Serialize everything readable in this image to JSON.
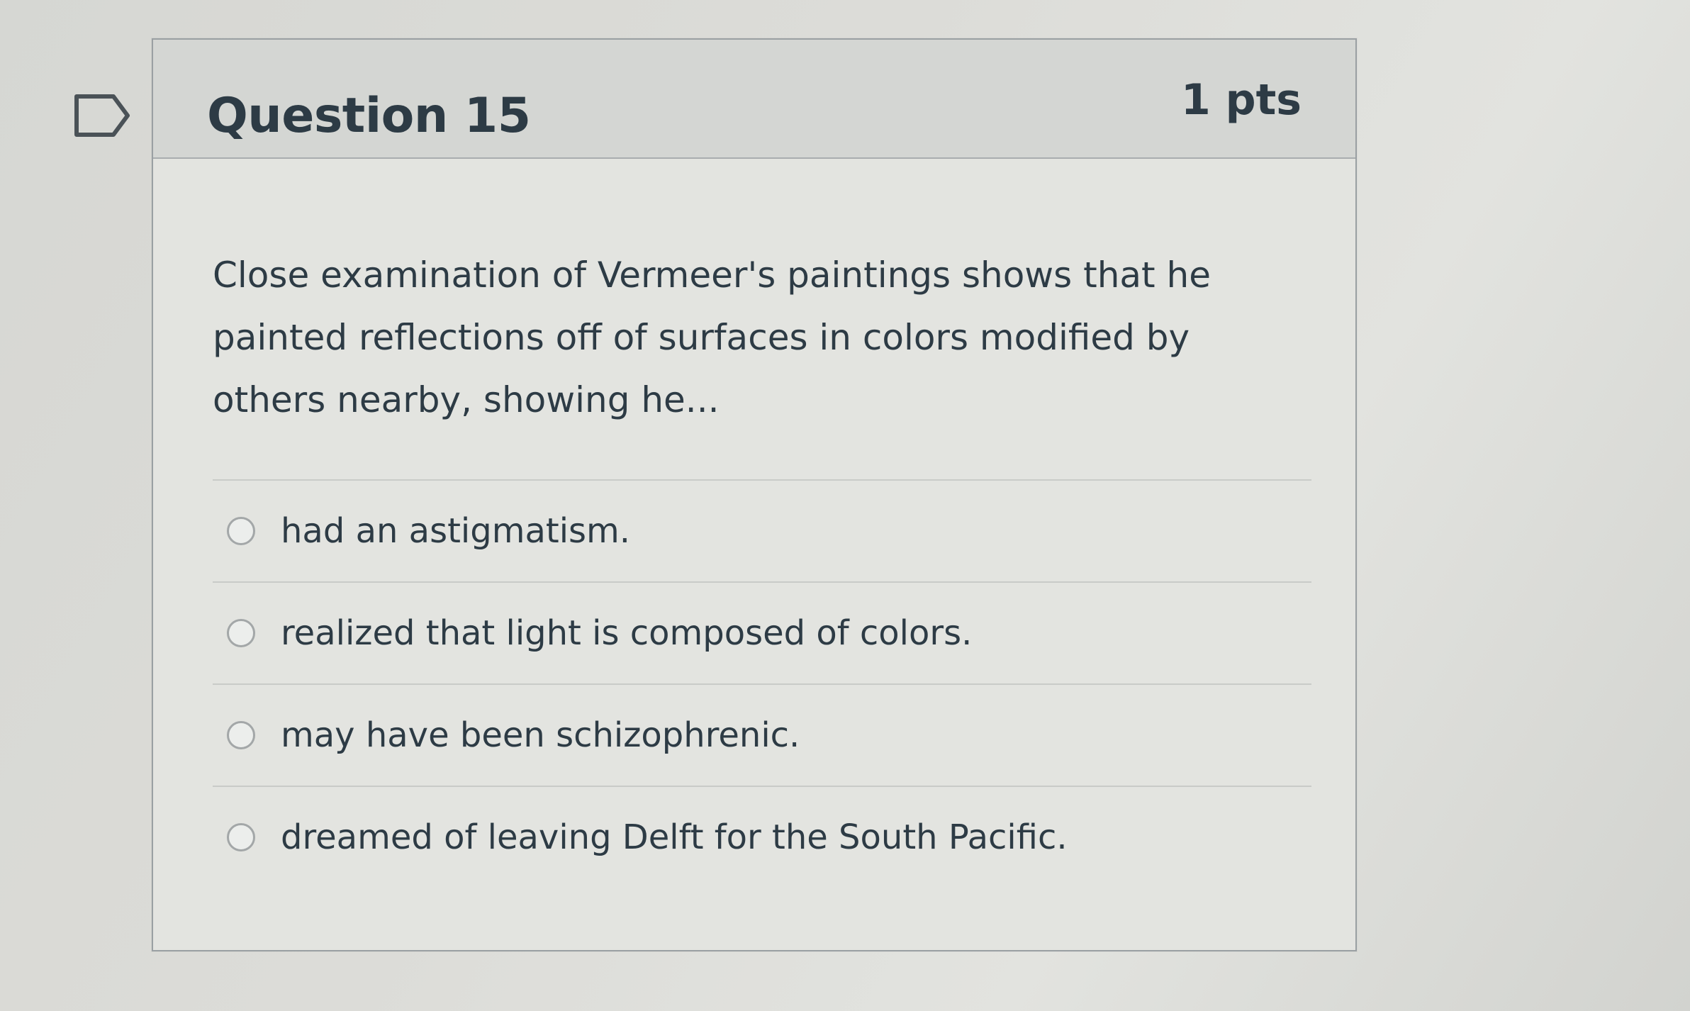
{
  "question": {
    "title": "Question 15",
    "points": "1 pts",
    "text": "Close examination of Vermeer's paintings shows that he painted reflections off of surfaces in colors modified by others nearby, showing he...",
    "flag_icon": "flag-outline-icon"
  },
  "answers": [
    {
      "label": "had an astigmatism.",
      "selected": false
    },
    {
      "label": "realized that light is composed of colors.",
      "selected": false
    },
    {
      "label": "may have been schizophrenic.",
      "selected": false
    },
    {
      "label": "dreamed of leaving Delft for the South Pacific.",
      "selected": false
    }
  ]
}
